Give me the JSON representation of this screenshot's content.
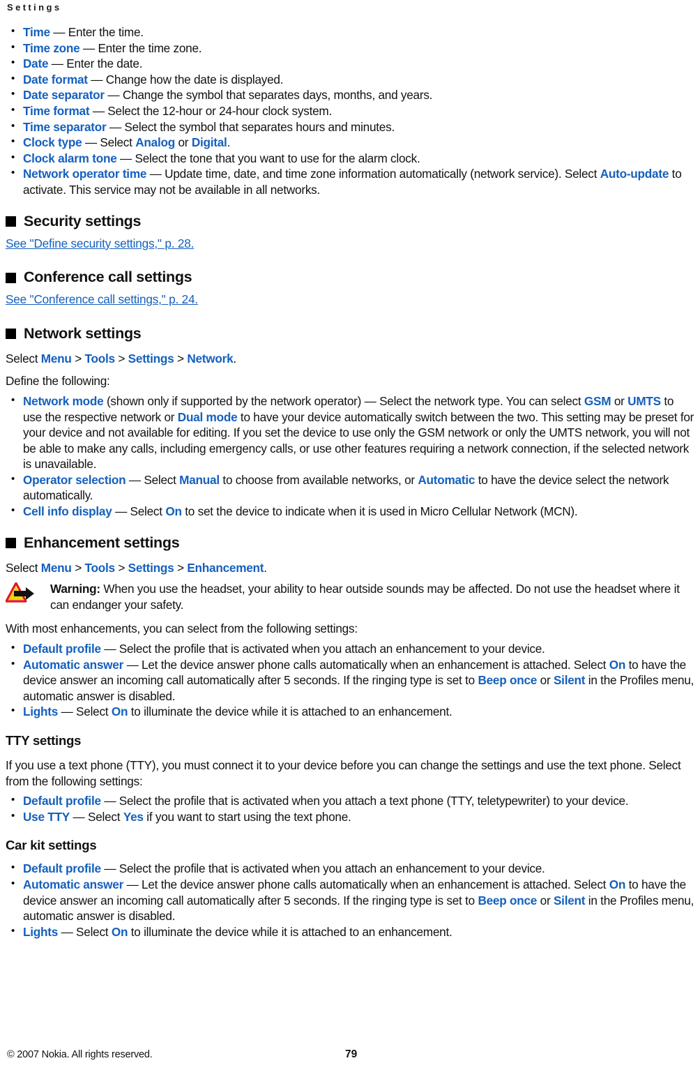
{
  "header": {
    "running_title": "Settings"
  },
  "time_settings_bullets": [
    {
      "term": "Time",
      "rest": " — Enter the time."
    },
    {
      "term": "Time zone",
      "rest": " — Enter the time zone."
    },
    {
      "term": "Date",
      "rest": " — Enter the date."
    },
    {
      "term": "Date format",
      "rest": " — Change how the date is displayed."
    },
    {
      "term": "Date separator",
      "rest": " — Change the symbol that separates days, months, and years."
    },
    {
      "term": "Time format",
      "rest": " — Select the 12-hour or 24-hour clock system."
    },
    {
      "term": "Time separator",
      "rest": " — Select the symbol that separates hours and minutes."
    },
    {
      "term": "Clock type",
      "rest": " — Select ",
      "val1": "Analog",
      "mid1": " or ",
      "val2": "Digital",
      "tail": "."
    },
    {
      "term": "Clock alarm tone",
      "rest": " — Select the tone that you want to use for the alarm clock."
    },
    {
      "term": "Network operator time",
      "rest": " — Update time, date, and time zone information automatically (network service). Select ",
      "val1": "Auto-update",
      "tail": " to activate. This service may not be available in all networks."
    }
  ],
  "security": {
    "heading": "Security settings",
    "xref": "See \"Define security settings,\" p. 28."
  },
  "conference": {
    "heading": "Conference call settings",
    "xref": "See \"Conference call settings,\" p. 24."
  },
  "network": {
    "heading": "Network settings",
    "path_lead": "Select ",
    "path": [
      "Menu",
      "Tools",
      "Settings",
      "Network"
    ],
    "path_sep": " > ",
    "path_end": ".",
    "intro": "Define the following:",
    "bullets": [
      {
        "term": "Network mode",
        "p1": " (shown only if supported by the network operator) — Select the network type. You can select ",
        "v1": "GSM",
        "p2": " or ",
        "v2": "UMTS",
        "p3": " to use the respective network or ",
        "v3": "Dual mode",
        "p4": " to have your device automatically switch between the two. This setting may be preset for your device and not available for editing. If you set the device to use only the GSM network or only the UMTS network, you will not be able to make any calls, including emergency calls, or use other features requiring a network connection, if the selected network is unavailable."
      },
      {
        "term": "Operator selection",
        "p1": " — Select ",
        "v1": "Manual",
        "p2": " to choose from available networks, or ",
        "v2": "Automatic",
        "p3": " to have the device select the network automatically."
      },
      {
        "term": "Cell info display",
        "p1": " — Select ",
        "v1": "On",
        "p2": " to set the device to indicate when it is used in Micro Cellular Network (MCN)."
      }
    ]
  },
  "enhancement": {
    "heading": "Enhancement settings",
    "path_lead": "Select ",
    "path": [
      "Menu",
      "Tools",
      "Settings",
      "Enhancement"
    ],
    "path_sep": " > ",
    "path_end": ".",
    "warning": {
      "icon": "warning-triangle-arrow-icon",
      "label": "Warning:",
      "text": "  When you use the headset, your ability to hear outside sounds may be affected. Do not use the headset where it can endanger your safety."
    },
    "intro": "With most enhancements, you can select from the following settings:",
    "bullets": [
      {
        "term": "Default profile",
        "p1": " — Select the profile that is activated when you attach an enhancement to your device."
      },
      {
        "term": "Automatic answer",
        "p1": " — Let the device answer phone calls automatically when an enhancement is attached. Select ",
        "v1": "On",
        "p2": " to have the device answer an incoming call automatically after 5 seconds. If the ringing type is set to ",
        "v2": "Beep once",
        "p3": " or ",
        "v3": "Silent",
        "p4": " in the Profiles menu, automatic answer is disabled."
      },
      {
        "term": "Lights",
        "p1": " — Select ",
        "v1": "On",
        "p2": " to illuminate the device while it is attached to an enhancement."
      }
    ]
  },
  "tty": {
    "heading": "TTY settings",
    "intro": "If you use a text phone (TTY), you must connect it to your device before you can change the settings and use the text phone. Select from the following settings:",
    "bullets": [
      {
        "term": "Default profile",
        "p1": " — Select the profile that is activated when you attach a text phone (TTY, teletypewriter) to your device."
      },
      {
        "term": "Use TTY",
        "p1": " — Select ",
        "v1": "Yes",
        "p2": " if you want to start using the text phone."
      }
    ]
  },
  "carkit": {
    "heading": "Car kit settings",
    "bullets": [
      {
        "term": "Default profile",
        "p1": " — Select the profile that is activated when you attach an enhancement to your device."
      },
      {
        "term": "Automatic answer",
        "p1": " — Let the device answer phone calls automatically when an enhancement is attached. Select ",
        "v1": "On",
        "p2": " to have the device answer an incoming call automatically after 5 seconds. If the ringing type is set to ",
        "v2": "Beep once",
        "p3": " or ",
        "v3": "Silent",
        "p4": " in the Profiles menu, automatic answer is disabled."
      },
      {
        "term": "Lights",
        "p1": " — Select ",
        "v1": "On",
        "p2": " to illuminate the device while it is attached to an enhancement."
      }
    ]
  },
  "footer": {
    "copyright": "© 2007 Nokia. All rights reserved.",
    "page_number": "79"
  },
  "colors": {
    "link_blue": "#1560BD",
    "text_black": "#121212",
    "warn_red": "#E11A1A",
    "warn_yellow": "#F2D500"
  }
}
